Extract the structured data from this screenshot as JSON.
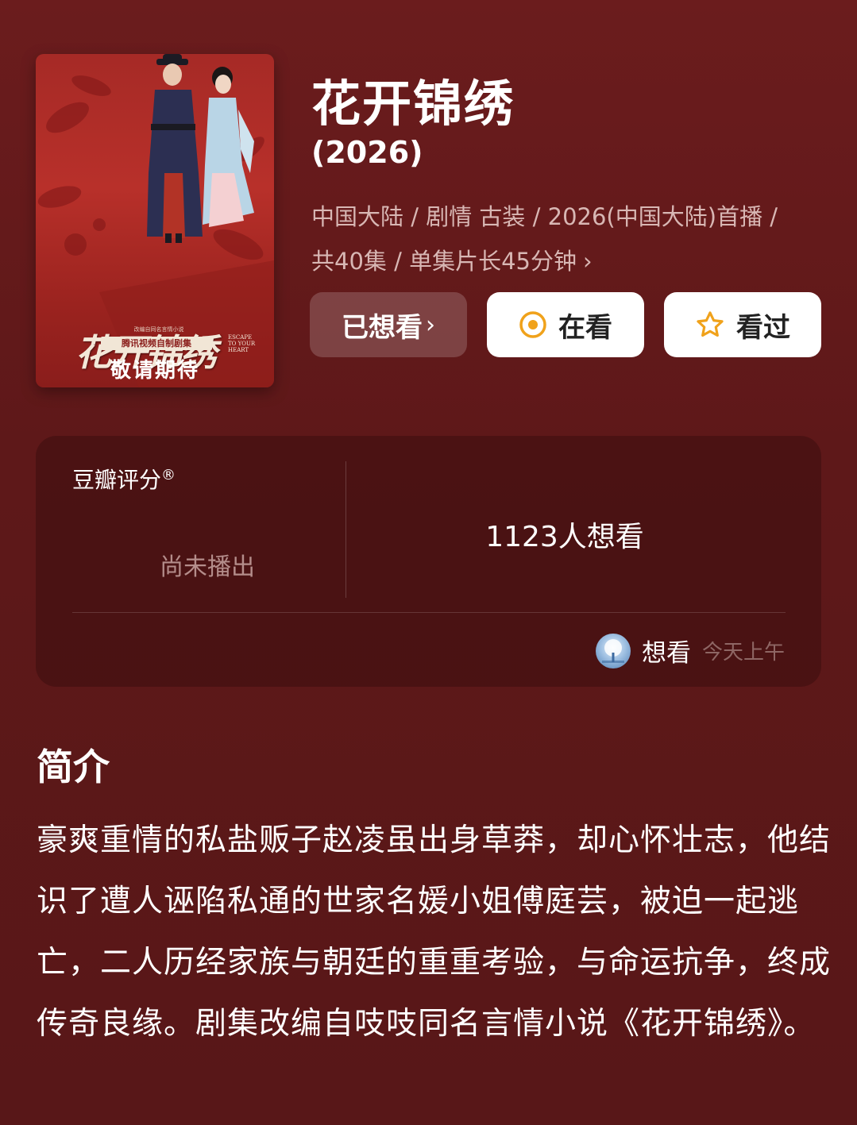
{
  "poster": {
    "title_art": "花开锦绣",
    "english_title": "ESCAPE TO YOUR HEART",
    "small_line": "改编自同名言情小说",
    "badge": "腾讯视频自制剧集",
    "coming": "敬请期待"
  },
  "show": {
    "title": "花开锦绣",
    "year": "(2026)",
    "meta": "中国大陆 / 剧情 古装 / 2026(中国大陆)首播 / 共40集 / 单集片长45分钟",
    "meta_chevron": "›"
  },
  "buttons": {
    "wanted_label": "已想看",
    "wanted_arrow": "›",
    "watching_label": "在看",
    "watched_label": "看过"
  },
  "rating": {
    "label": "豆瓣评分",
    "registered_mark": "®",
    "status": "尚未播出",
    "want_count": "1123人想看",
    "activity_action": "想看",
    "activity_time": "今天上午"
  },
  "synopsis": {
    "heading": "简介",
    "text": "豪爽重情的私盐贩子赵凌虽出身草莽，却心怀壮志，他结识了遭人诬陷私通的世家名媛小姐傅庭芸，被迫一起逃亡，二人历经家族与朝廷的重重考验，与命运抗争，终成传奇良缘。剧集改编自吱吱同名言情小说《花开锦绣》。"
  },
  "colors": {
    "background": "#5e1819",
    "accent_orange": "#f0a21b",
    "button_white": "#ffffff",
    "muted_text": "#d8b7b4"
  },
  "icons": {
    "watching": "target-circle-icon",
    "watched": "star-outline-icon"
  }
}
